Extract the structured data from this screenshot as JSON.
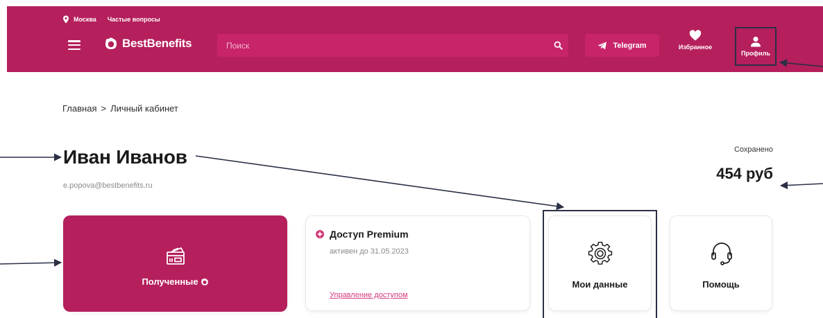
{
  "header": {
    "city": "Москва",
    "faq": "Частые вопросы",
    "logo": "BestBenefits",
    "search_placeholder": "Поиск",
    "telegram": "Telegram",
    "favorites": "Избранное",
    "profile": "Профиль"
  },
  "breadcrumb": {
    "home": "Главная",
    "separator": ">",
    "current": "Личный кабинет"
  },
  "user": {
    "name": "Иван Иванов",
    "email": "e.popova@bestbenefits.ru"
  },
  "saved": {
    "label": "Сохранено",
    "value": "454 руб"
  },
  "cards": {
    "received": {
      "label": "Полученные",
      "icon": "ticket-icon"
    },
    "premium": {
      "title": "Доступ Premium",
      "subtitle": "активен до 31.05.2023",
      "link": "Управление доступом"
    },
    "my_data": {
      "label": "Мои данные",
      "icon": "gear-icon"
    },
    "help": {
      "label": "Помощь",
      "icon": "headset-icon"
    }
  },
  "colors": {
    "brand": "#b51f5c",
    "brand_light": "#c8246a",
    "link": "#d23c7c",
    "annotation": "#2a2f45"
  }
}
